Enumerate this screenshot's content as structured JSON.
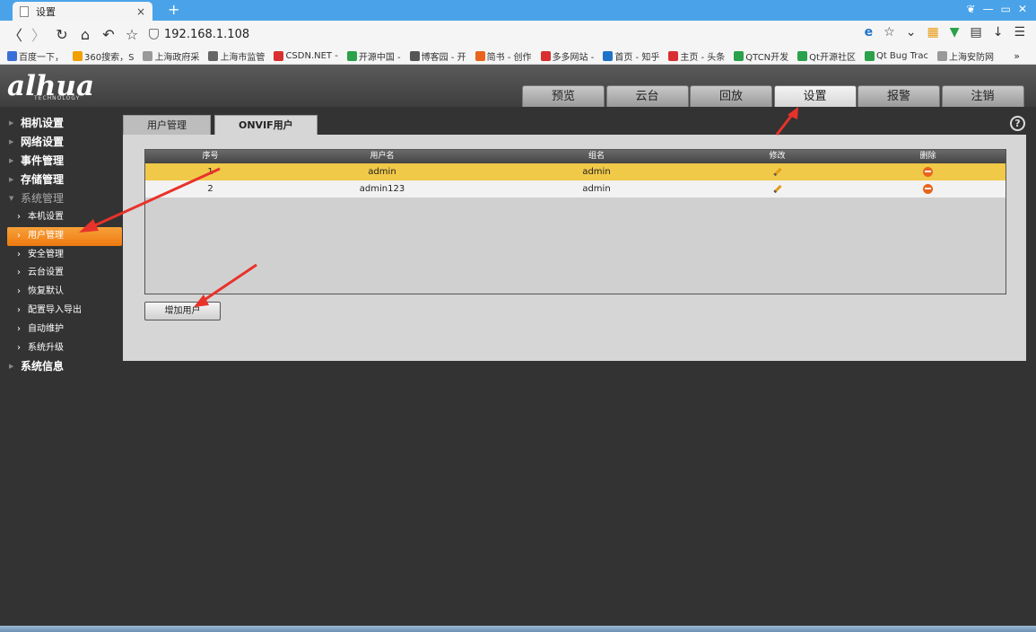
{
  "browser": {
    "tab_title": "设置",
    "tab_close": "×",
    "new_tab": "+",
    "address": "192.168.1.108",
    "bookmarks": [
      {
        "label": "百度一下，",
        "color": "#3a6fd8"
      },
      {
        "label": "360搜索，S",
        "color": "#f0a000"
      },
      {
        "label": "上海政府采",
        "color": "#999999"
      },
      {
        "label": "上海市监管",
        "color": "#666666"
      },
      {
        "label": "CSDN.NET -",
        "color": "#d83030"
      },
      {
        "label": "开源中国 -",
        "color": "#2aa14a"
      },
      {
        "label": "博客园 - 开",
        "color": "#555555"
      },
      {
        "label": "简书 - 创作",
        "color": "#e8641e"
      },
      {
        "label": "多多网站 -",
        "color": "#d83030"
      },
      {
        "label": "首页 - 知乎",
        "color": "#1e73c8"
      },
      {
        "label": "主页 - 头条",
        "color": "#d83030"
      },
      {
        "label": "QTCN开发",
        "color": "#2aa14a"
      },
      {
        "label": "Qt开源社区",
        "color": "#2aa14a"
      },
      {
        "label": "Qt Bug Trac",
        "color": "#2aa14a"
      },
      {
        "label": "上海安防网",
        "color": "#999999"
      }
    ],
    "bookmarks_more": "»"
  },
  "app": {
    "logo": "alhua",
    "logo_sub": "TECHNOLOGY",
    "main_tabs": [
      "预览",
      "云台",
      "回放",
      "设置",
      "报警",
      "注销"
    ],
    "active_main_tab": 3
  },
  "sidebar": {
    "sections": [
      {
        "label": "相机设置"
      },
      {
        "label": "网络设置"
      },
      {
        "label": "事件管理"
      },
      {
        "label": "存储管理"
      },
      {
        "label": "系统管理"
      }
    ],
    "items": [
      "本机设置",
      "用户管理",
      "安全管理",
      "云台设置",
      "恢复默认",
      "配置导入导出",
      "自动维护",
      "系统升级"
    ],
    "footer_section": "系统信息"
  },
  "sub_tabs": [
    "用户管理",
    "ONVIF用户"
  ],
  "help": "?",
  "table": {
    "headers": [
      "序号",
      "用户名",
      "组名",
      "修改",
      "删除"
    ],
    "rows": [
      {
        "index": "1",
        "username": "admin",
        "group": "admin"
      },
      {
        "index": "2",
        "username": "admin123",
        "group": "admin"
      }
    ]
  },
  "add_user_button": "增加用户",
  "colors": {
    "accent": "#ee7a10",
    "selected_row": "#f1c948",
    "annotation_arrow": "#e8322a"
  }
}
